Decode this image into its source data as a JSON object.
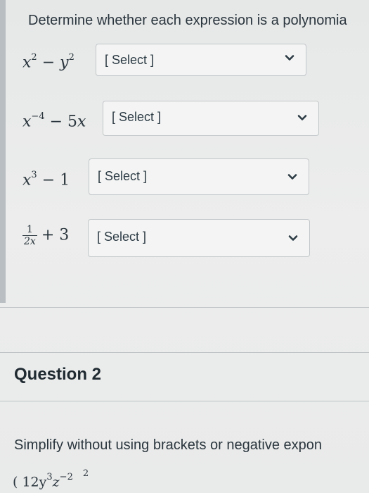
{
  "question1": {
    "prompt": "Determine whether each expression is a polynomia",
    "items": [
      {
        "expr_base1": "x",
        "expr_exp1": "2",
        "expr_op": " − ",
        "expr_base2": "y",
        "expr_exp2": "2",
        "select_value": "[ Select ]"
      },
      {
        "expr_base1": "x",
        "expr_exp1": "−4",
        "expr_op": " − 5",
        "expr_base2": "x",
        "expr_exp2": "",
        "select_value": "[ Select ]"
      },
      {
        "expr_base1": "x",
        "expr_exp1": "3",
        "expr_op": " − 1",
        "expr_base2": "",
        "expr_exp2": "",
        "select_value": "[ Select ]"
      },
      {
        "frac_num": "1",
        "frac_den": "2x",
        "expr_tail": "+ 3",
        "select_value": "[ Select ]"
      }
    ]
  },
  "question2": {
    "title": "Question 2",
    "prompt": "Simplify without using brackets or negative expon",
    "expr_partial": "( 12y",
    "expr_partial_exp1": "3",
    "expr_partial_mid": "z",
    "expr_partial_exp2": "−2",
    "expr_partial_outer_exp": "2"
  },
  "icons": {
    "dropdown": "chevron-down-icon"
  }
}
